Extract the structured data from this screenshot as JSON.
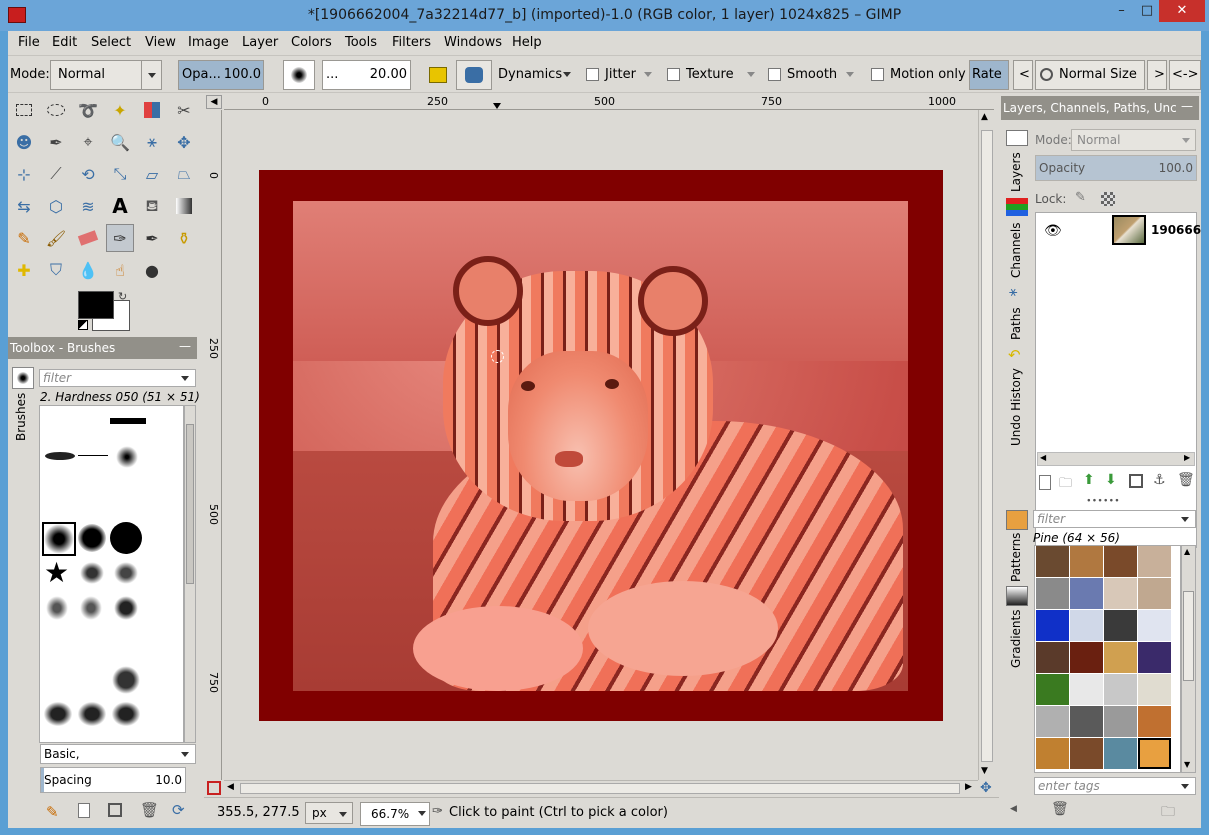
{
  "window": {
    "title": "*[1906662004_7a32214d77_b] (imported)-1.0 (RGB color, 1 layer) 1024x825 – GIMP",
    "minimize": "–",
    "maximize": "□",
    "close": "✕"
  },
  "menu": [
    "File",
    "Edit",
    "Select",
    "View",
    "Image",
    "Layer",
    "Colors",
    "Tools",
    "Filters",
    "Windows",
    "Help"
  ],
  "tool_options": {
    "mode_label": "Mode:",
    "mode_value": "Normal",
    "opacity_label": "Opa...",
    "opacity_value": "100.0",
    "size_label": "...",
    "size_value": "20.00",
    "dynamics": "Dynamics",
    "jitter": "Jitter",
    "texture": "Texture",
    "smooth": "Smooth",
    "motion_only": "Motion only",
    "rate": "Rate",
    "prev": "<",
    "normal_size": "Normal Size",
    "next": ">",
    "expand": "<->"
  },
  "rulers": {
    "h_ticks": [
      "0",
      "250",
      "500",
      "750",
      "1000"
    ],
    "v_ticks": [
      "0",
      "250",
      "500",
      "750"
    ]
  },
  "brushes": {
    "header": "Toolbox - Brushes",
    "filter_placeholder": "filter",
    "tab": "Brushes",
    "selected": "2. Hardness 050 (51 × 51)",
    "tag_value": "Basic,",
    "spacing_label": "Spacing",
    "spacing_value": "10.0"
  },
  "status": {
    "coords": "355.5, 277.5",
    "unit": "px",
    "zoom": "66.7%",
    "message": "Click to paint (Ctrl to pick a color)"
  },
  "layers_dock": {
    "header": "Layers, Channels, Paths, Unc",
    "mode_label": "Mode:",
    "mode_value": "Normal",
    "opacity_label": "Opacity",
    "opacity_value": "100.0",
    "lock_label": "Lock:",
    "layer_name": "190666",
    "tabs": [
      "Layers",
      "Channels",
      "Paths",
      "Undo History"
    ]
  },
  "patterns_dock": {
    "filter_placeholder": "filter",
    "selected": "Pine (64 × 56)",
    "tags_placeholder": "enter tags",
    "tabs": [
      "Patterns",
      "Gradients"
    ]
  },
  "colors": {
    "frame": "#800000",
    "overlay": "#e05050",
    "accent": "#6ba5d8"
  }
}
